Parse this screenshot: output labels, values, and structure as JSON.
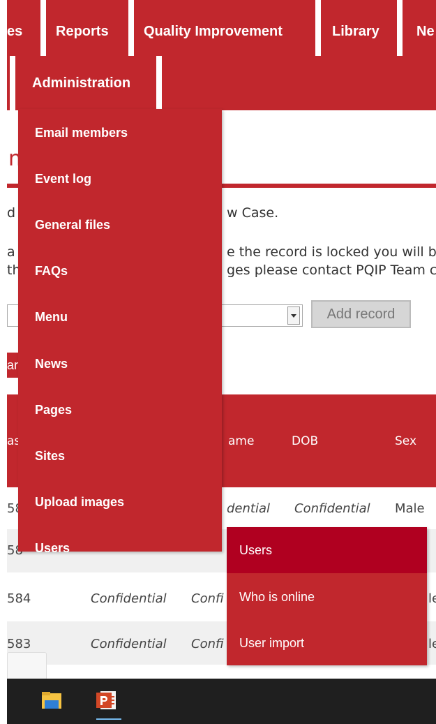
{
  "nav": {
    "items": [
      "es",
      "Reports",
      "Quality Improvement",
      "Library",
      "Ne"
    ],
    "admin": "Administration"
  },
  "admin_menu": [
    "Email members",
    "Event log",
    "General files",
    "FAQs",
    "Menu",
    "News",
    "Pages",
    "Sites",
    "Upload images",
    "Users"
  ],
  "users_submenu": [
    "Users",
    "Who is online",
    "User import"
  ],
  "page": {
    "title_fragment": "n",
    "line1_left": "d",
    "line1_right": "w Case.",
    "line2_left": "a",
    "line2_right": "e the record is locked you will b",
    "line3_left": "th",
    "line3_right": "ges please contact PQIP Team c",
    "button_fragment": "ar"
  },
  "add_record": {
    "button": "Add record",
    "dropdown_icon": "caret-down-icon"
  },
  "table": {
    "headers": [
      "as",
      "ame",
      "DOB",
      "Sex"
    ],
    "rows": [
      [
        "58",
        "dential",
        "Confidential",
        "Male"
      ],
      [
        "58",
        "",
        "",
        ""
      ],
      [
        "584",
        "Confidential",
        "Confi",
        "le"
      ],
      [
        "583",
        "Confidential",
        "Confi",
        "le"
      ]
    ]
  },
  "taskbar": {
    "icons": [
      "file-explorer-icon",
      "powerpoint-icon"
    ]
  },
  "colors": {
    "red": "#c1272d",
    "dark_red": "#b00020",
    "taskbar": "#1f1f1f"
  }
}
